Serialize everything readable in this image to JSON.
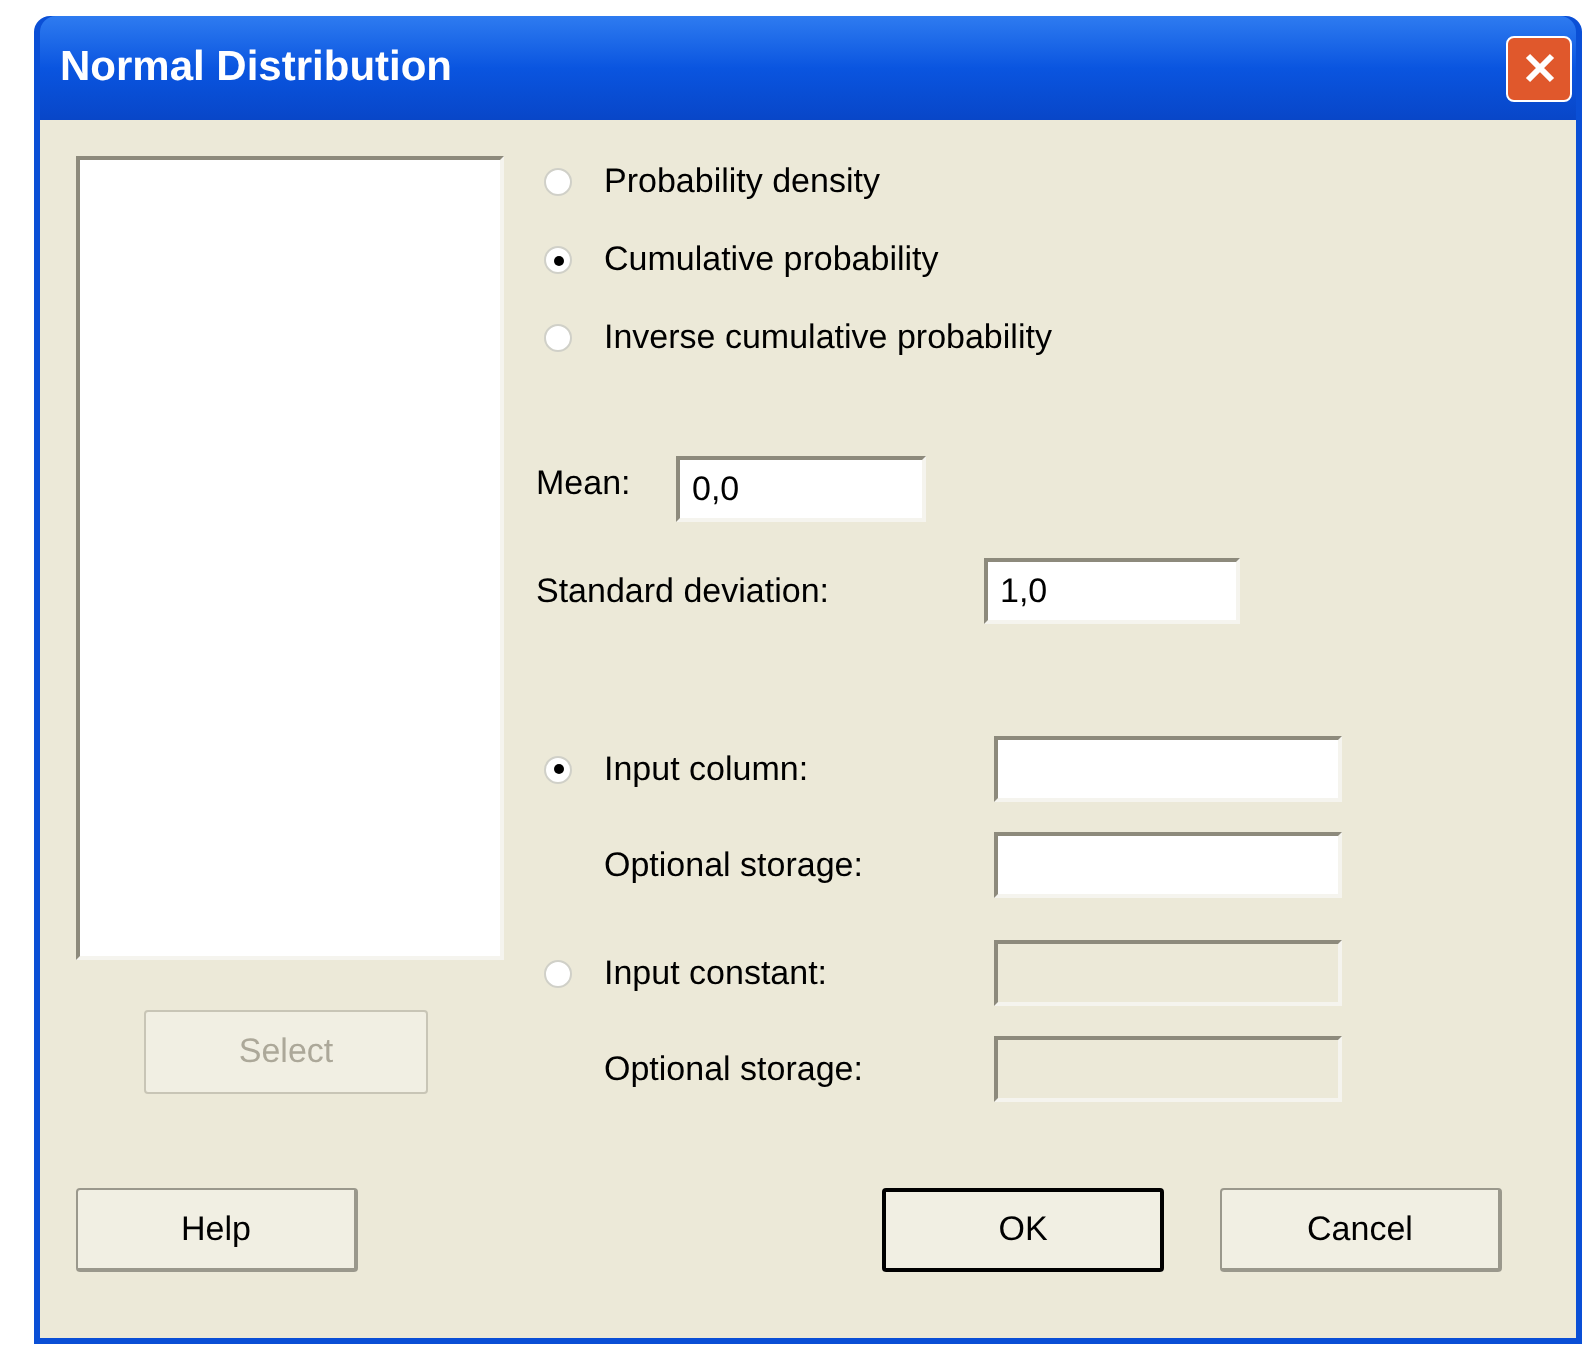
{
  "window": {
    "title": "Normal Distribution"
  },
  "select_button": {
    "label": "Select",
    "disabled": true
  },
  "functions": [
    {
      "label": "Probability density",
      "selected": false
    },
    {
      "label": "Cumulative probability",
      "selected": true
    },
    {
      "label": "Inverse cumulative probability",
      "selected": false
    }
  ],
  "mean": {
    "label": "Mean:",
    "value": "0,0"
  },
  "standard_deviation": {
    "label": "Standard deviation:",
    "value": "1,0"
  },
  "inputs": [
    {
      "label": "Input column:",
      "selected": true,
      "field_disabled": false,
      "storage": {
        "label": "Optional storage:",
        "disabled": false
      }
    },
    {
      "label": "Input constant:",
      "selected": false,
      "field_disabled": true,
      "storage": {
        "label": "Optional storage:",
        "disabled": true
      }
    }
  ],
  "buttons": [
    {
      "label": "Help",
      "default": false
    },
    {
      "label": "OK",
      "default": true
    },
    {
      "label": "Cancel",
      "default": false
    }
  ]
}
